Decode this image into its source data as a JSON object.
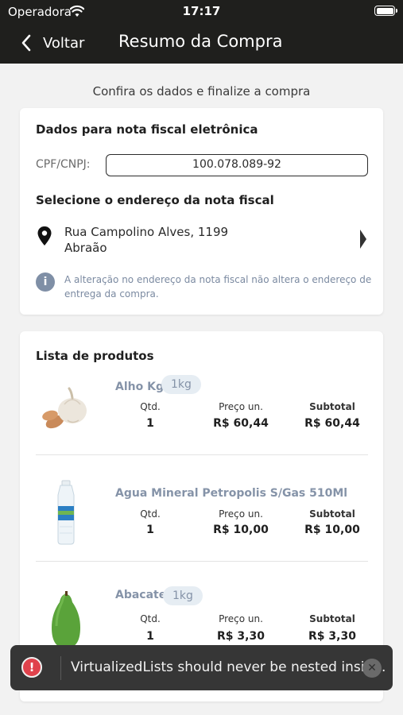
{
  "status_bar": {
    "carrier": "Operadora",
    "time": "17:17"
  },
  "nav": {
    "back_label": "Voltar",
    "title": "Resumo da Compra"
  },
  "subtitle": "Confira os dados e finalize a compra",
  "invoice": {
    "heading": "Dados para nota fiscal eletrônica",
    "cpf_label": "CPF/CNPJ:",
    "cpf_value": "100.078.089-92",
    "address_heading": "Selecione o endereço da nota fiscal",
    "address_line1": "Rua Campolino Alves, 1199",
    "address_line2": "Abraão",
    "info_icon": "i",
    "info_text": "A alteração no endereço da nota fiscal não altera o endereço de entrega da compra."
  },
  "products": {
    "heading": "Lista de produtos",
    "col_qty": "Qtd.",
    "col_price": "Preço un.",
    "col_subtotal": "Subtotal",
    "items": [
      {
        "name": "Alho Kg",
        "badge": "1kg",
        "qty": "1",
        "price": "R$ 60,44",
        "subtotal": "R$ 60,44",
        "icon": "garlic-image"
      },
      {
        "name": "Agua Mineral Petropolis S/Gas 510Ml",
        "badge": "",
        "qty": "1",
        "price": "R$ 10,00",
        "subtotal": "R$ 10,00",
        "icon": "water-bottle-image"
      },
      {
        "name": "Abacate",
        "badge": "1kg",
        "qty": "1",
        "price": "R$ 3,30",
        "subtotal": "R$ 3,30",
        "icon": "avocado-image"
      }
    ]
  },
  "toast": {
    "icon": "!",
    "message": "VirtualizedLists should never be nested insid...",
    "close": "✕"
  },
  "colors": {
    "header_bg": "#1f1f1d",
    "accent_text": "#8593a8",
    "toast_bg": "#363636",
    "error": "#e0424c"
  }
}
